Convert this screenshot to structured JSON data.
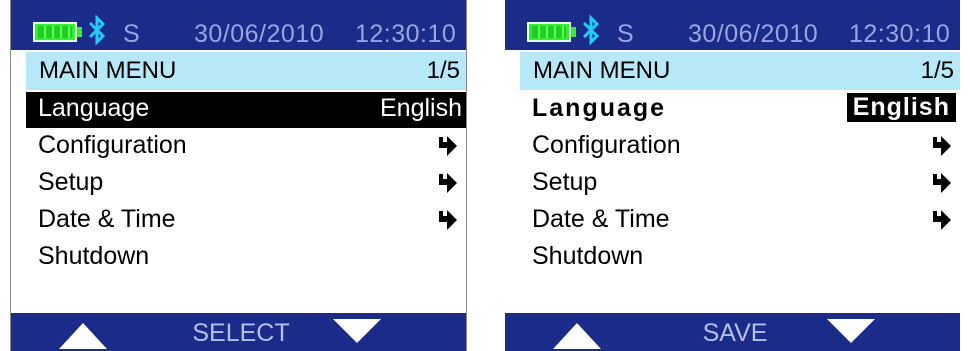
{
  "colors": {
    "status_bar": "#1b2b8a",
    "header_bg": "#b7e8f8",
    "battery": "#33ee33",
    "bluetooth": "#22ccff",
    "selection": "#000000"
  },
  "screens": [
    {
      "status": {
        "battery_icon": "battery-full-icon",
        "bluetooth_icon": "bluetooth-icon",
        "mode": "S",
        "date": "30/06/2010",
        "time": "12:30:10"
      },
      "header": {
        "title": "MAIN MENU",
        "page": "1/5"
      },
      "items": [
        {
          "label": "Language",
          "value": "English",
          "selected": true
        },
        {
          "label": "Configuration",
          "icon": "right-arrow-icon"
        },
        {
          "label": "Setup",
          "icon": "right-arrow-icon"
        },
        {
          "label": "Date & Time",
          "icon": "right-arrow-icon"
        },
        {
          "label": "Shutdown"
        }
      ],
      "footer": {
        "up_icon": "up-triangle-icon",
        "softkey": "SELECT",
        "down_icon": "down-triangle-icon"
      }
    },
    {
      "status": {
        "battery_icon": "battery-full-icon",
        "bluetooth_icon": "bluetooth-icon",
        "mode": "S",
        "date": "30/06/2010",
        "time": "12:30:10"
      },
      "header": {
        "title": "MAIN MENU",
        "page": "1/5"
      },
      "items": [
        {
          "label": "Language",
          "value": "English",
          "editing": true
        },
        {
          "label": "Configuration",
          "icon": "right-arrow-icon"
        },
        {
          "label": "Setup",
          "icon": "right-arrow-icon"
        },
        {
          "label": "Date & Time",
          "icon": "right-arrow-icon"
        },
        {
          "label": "Shutdown"
        }
      ],
      "footer": {
        "up_icon": "up-triangle-icon",
        "softkey": "SAVE",
        "down_icon": "down-triangle-icon"
      }
    }
  ]
}
